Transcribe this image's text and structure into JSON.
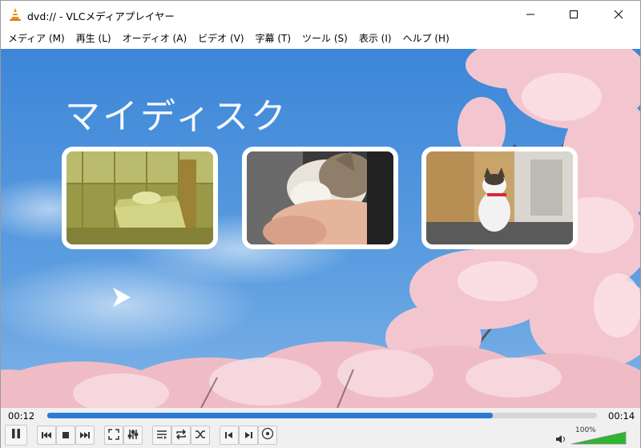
{
  "window": {
    "title": "dvd:// - VLCメディアプレイヤー"
  },
  "menu": [
    "メディア (M)",
    "再生 (L)",
    "オーディオ (A)",
    "ビデオ (V)",
    "字幕 (T)",
    "ツール (S)",
    "表示 (I)",
    "ヘルプ (H)"
  ],
  "video": {
    "disc_title": "マイディスク",
    "chapters": [
      {
        "name": "chapter-1",
        "subject": "cat in greenhouse box"
      },
      {
        "name": "chapter-2",
        "subject": "kitten being petted"
      },
      {
        "name": "chapter-3",
        "subject": "cat with red collar"
      }
    ]
  },
  "playback": {
    "elapsed": "00:12",
    "total": "00:14",
    "progress": 0.81
  },
  "volume": {
    "label": "100%",
    "level": 1.0
  },
  "colors": {
    "accent": "#2a7bd6",
    "sky": "#4a90d9",
    "blossom": "#f3c6cf",
    "volume": "#2fb52f"
  },
  "icons": {
    "app": "vlc-cone-icon",
    "minimize": "minimize-icon",
    "maximize": "maximize-icon",
    "close": "close-icon",
    "pause": "pause-icon",
    "prev": "previous-icon",
    "stop": "stop-icon",
    "next": "next-icon",
    "fullscreen": "fullscreen-icon",
    "extended": "extended-settings-icon",
    "playlist": "playlist-icon",
    "loop": "loop-icon",
    "shuffle": "shuffle-icon",
    "frame_back": "frame-back-icon",
    "frame_fwd": "frame-forward-icon",
    "dvd_menu": "disc-menu-icon",
    "speaker": "speaker-icon"
  }
}
